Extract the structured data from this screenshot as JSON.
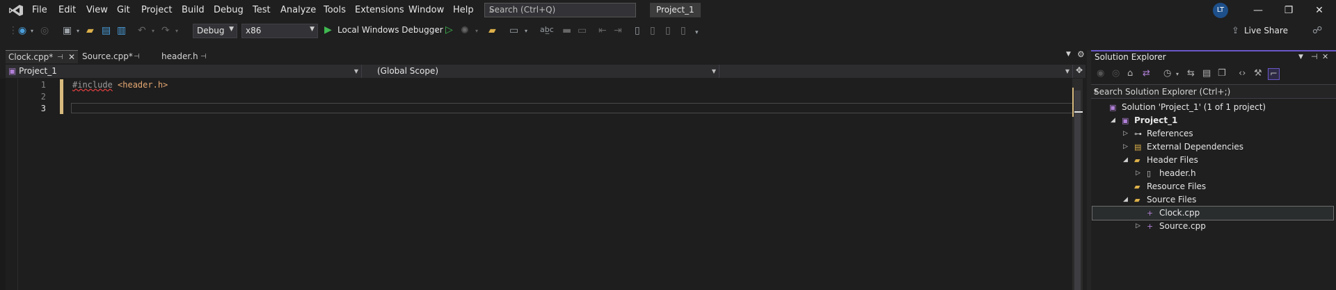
{
  "menu": {
    "items": [
      "File",
      "Edit",
      "View",
      "Git",
      "Project",
      "Build",
      "Debug",
      "Test",
      "Analyze",
      "Tools",
      "Extensions",
      "Window",
      "Help"
    ],
    "search_placeholder": "Search (Ctrl+Q)",
    "project_name": "Project_1",
    "user_initials": "LT"
  },
  "toolbar": {
    "configuration": "Debug",
    "platform": "x86",
    "debugger_label": "Local Windows Debugger",
    "live_share": "Live Share"
  },
  "tabs": [
    {
      "label": "Clock.cpp*",
      "active": true
    },
    {
      "label": "Source.cpp*",
      "active": false
    },
    {
      "label": "header.h",
      "active": false
    }
  ],
  "navbar": {
    "project": "Project_1",
    "scope": "(Global Scope)"
  },
  "editor": {
    "lines": [
      {
        "number": "1",
        "keyword": "#include",
        "argument": "<header.h>"
      },
      {
        "number": "2",
        "keyword": "",
        "argument": ""
      },
      {
        "number": "3",
        "keyword": "",
        "argument": ""
      }
    ],
    "current_line": 3
  },
  "solution_explorer": {
    "title": "Solution Explorer",
    "search_placeholder": "Search Solution Explorer (Ctrl+;)",
    "tree": [
      {
        "label": "Solution 'Project_1' (1 of 1 project)",
        "depth": 0,
        "caret": "",
        "icon": "solution-icon"
      },
      {
        "label": "Project_1",
        "depth": 1,
        "caret": "◢",
        "icon": "project-icon",
        "bold": true
      },
      {
        "label": "References",
        "depth": 2,
        "caret": "▷",
        "icon": "references-icon"
      },
      {
        "label": "External Dependencies",
        "depth": 2,
        "caret": "▷",
        "icon": "external-dependencies-icon"
      },
      {
        "label": "Header Files",
        "depth": 2,
        "caret": "◢",
        "icon": "folder-filter-icon"
      },
      {
        "label": "header.h",
        "depth": 3,
        "caret": "▷",
        "icon": "header-file-icon"
      },
      {
        "label": "Resource Files",
        "depth": 2,
        "caret": "",
        "icon": "folder-filter-icon"
      },
      {
        "label": "Source Files",
        "depth": 2,
        "caret": "◢",
        "icon": "folder-filter-icon"
      },
      {
        "label": "Clock.cpp",
        "depth": 3,
        "caret": "",
        "icon": "cpp-file-icon",
        "selected": true
      },
      {
        "label": "Source.cpp",
        "depth": 3,
        "caret": "▷",
        "icon": "cpp-file-icon"
      }
    ]
  },
  "colors": {
    "background": "#1f1f1f",
    "editor_bg": "#1e1e1e",
    "accent": "#6a58c9",
    "change_marker": "#d7ba7d",
    "run_green": "#3fb950"
  }
}
